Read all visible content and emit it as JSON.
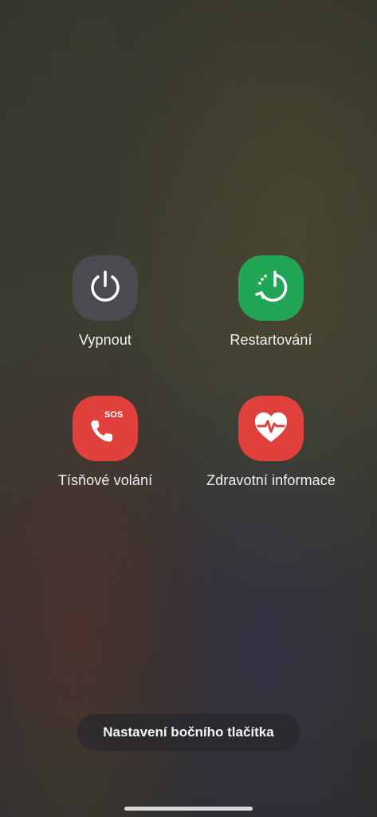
{
  "actions": {
    "power_off": {
      "label": "Vypnout",
      "icon": "power-icon",
      "color": "#4a4a50"
    },
    "restart": {
      "label": "Restartování",
      "icon": "restart-icon",
      "color": "#21a655"
    },
    "emergency_call": {
      "label": "Tísňové volání",
      "icon": "sos-phone-icon",
      "icon_text": "SOS",
      "color": "#e0413d"
    },
    "medical_info": {
      "label": "Zdravotní informace",
      "icon": "heart-pulse-icon",
      "color": "#e0413d"
    }
  },
  "side_button_settings": {
    "label": "Nastavení bočního tlačítka"
  }
}
